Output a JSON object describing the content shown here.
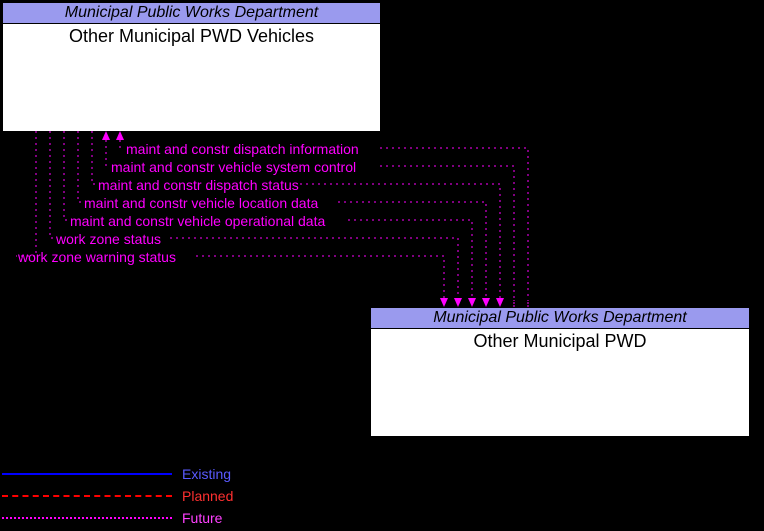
{
  "boxes": {
    "top": {
      "header": "Municipal Public Works Department",
      "body": "Other Municipal PWD Vehicles"
    },
    "bottom": {
      "header": "Municipal Public Works Department",
      "body": "Other Municipal PWD"
    }
  },
  "flows": [
    {
      "label": "maint and constr dispatch information",
      "dir": "to_top"
    },
    {
      "label": "maint and constr vehicle system control",
      "dir": "to_top"
    },
    {
      "label": "maint and constr dispatch status",
      "dir": "to_bottom"
    },
    {
      "label": "maint and constr vehicle location data",
      "dir": "to_bottom"
    },
    {
      "label": "maint and constr vehicle operational data",
      "dir": "to_bottom"
    },
    {
      "label": "work zone status",
      "dir": "to_bottom"
    },
    {
      "label": "work zone warning status",
      "dir": "to_bottom"
    }
  ],
  "legend": {
    "existing": "Existing",
    "planned": "Planned",
    "future": "Future"
  },
  "chart_data": {
    "type": "diagram",
    "nodes": [
      {
        "id": "top",
        "org": "Municipal Public Works Department",
        "name": "Other Municipal PWD Vehicles"
      },
      {
        "id": "bottom",
        "org": "Municipal Public Works Department",
        "name": "Other Municipal PWD"
      }
    ],
    "edges": [
      {
        "from": "bottom",
        "to": "top",
        "label": "maint and constr dispatch information",
        "status": "Future"
      },
      {
        "from": "bottom",
        "to": "top",
        "label": "maint and constr vehicle system control",
        "status": "Future"
      },
      {
        "from": "top",
        "to": "bottom",
        "label": "maint and constr dispatch status",
        "status": "Future"
      },
      {
        "from": "top",
        "to": "bottom",
        "label": "maint and constr vehicle location data",
        "status": "Future"
      },
      {
        "from": "top",
        "to": "bottom",
        "label": "maint and constr vehicle operational data",
        "status": "Future"
      },
      {
        "from": "top",
        "to": "bottom",
        "label": "work zone status",
        "status": "Future"
      },
      {
        "from": "top",
        "to": "bottom",
        "label": "work zone warning status",
        "status": "Future"
      }
    ],
    "legend": [
      "Existing",
      "Planned",
      "Future"
    ]
  }
}
